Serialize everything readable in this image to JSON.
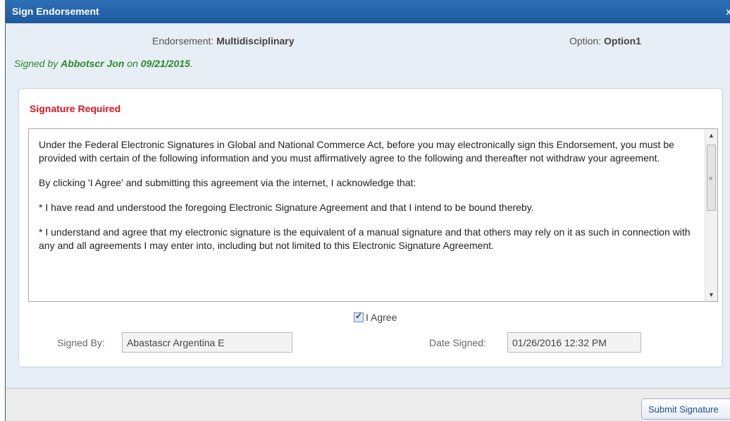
{
  "dialog": {
    "title": "Sign Endorsement",
    "close_label": "x"
  },
  "header": {
    "endorsement_label": "Endorsement:",
    "endorsement_value": "Multidisciplinary",
    "option_label": "Option:",
    "option_value": "Option1"
  },
  "signed_note": {
    "prefix": "Signed by",
    "name": "Abbotscr Jon",
    "on": "on",
    "date": "09/21/2015",
    "suffix": "."
  },
  "panel": {
    "heading": "Signature Required",
    "agreement_paragraphs": [
      "Under the Federal Electronic Signatures in Global and National Commerce Act, before you may electronically sign this Endorsement, you must be provided with certain of the following information and you must affirmatively agree to the following and thereafter not withdraw your agreement.",
      "By clicking 'I Agree' and submitting this agreement via the internet, I acknowledge that:",
      "* I have read and understood the foregoing Electronic Signature Agreement and that I intend to be bound thereby.",
      "* I understand and agree that my electronic signature is the equivalent of a manual signature and that others may rely on it as such in connection with any and all agreements I may enter into, including but not limited to this Electronic Signature Agreement."
    ],
    "agree_label": "I Agree",
    "agree_checked": true,
    "signed_by_label": "Signed By:",
    "signed_by_value": "Abastascr Argentina E",
    "date_signed_label": "Date Signed:",
    "date_signed_value": "01/26/2016 12:32 PM"
  },
  "footer": {
    "submit_label": "Submit Signature"
  },
  "colors": {
    "title_bar": "#1d5a9f",
    "signed_note": "#2a8a2a",
    "required": "#e0141b"
  }
}
